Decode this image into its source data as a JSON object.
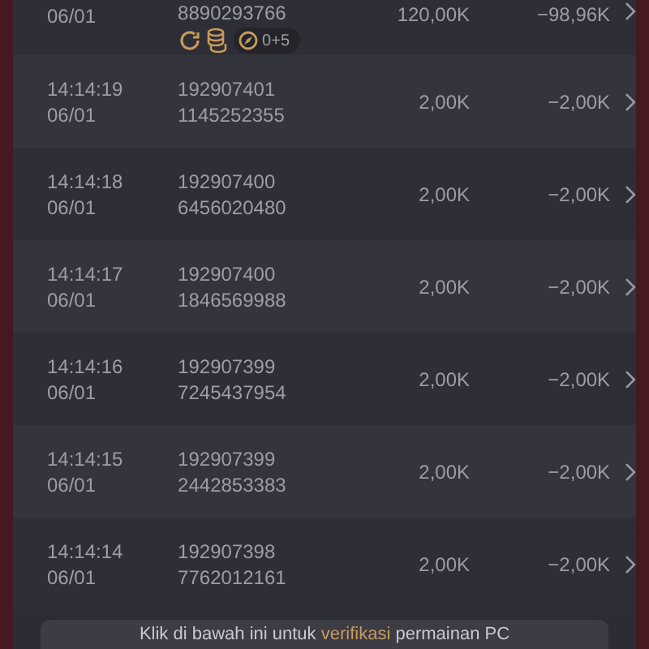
{
  "rows": [
    {
      "date": "06/01",
      "id_line_2": "8890293766",
      "amount": "120,00K",
      "result": "−98,96K",
      "badge": "0+5"
    },
    {
      "time": "14:14:19",
      "date": "06/01",
      "id_line_1": "192907401",
      "id_line_2": "1145252355",
      "amount": "2,00K",
      "result": "−2,00K"
    },
    {
      "time": "14:14:18",
      "date": "06/01",
      "id_line_1": "192907400",
      "id_line_2": "6456020480",
      "amount": "2,00K",
      "result": "−2,00K"
    },
    {
      "time": "14:14:17",
      "date": "06/01",
      "id_line_1": "192907400",
      "id_line_2": "1846569988",
      "amount": "2,00K",
      "result": "−2,00K"
    },
    {
      "time": "14:14:16",
      "date": "06/01",
      "id_line_1": "192907399",
      "id_line_2": "7245437954",
      "amount": "2,00K",
      "result": "−2,00K"
    },
    {
      "time": "14:14:15",
      "date": "06/01",
      "id_line_1": "192907399",
      "id_line_2": "2442853383",
      "amount": "2,00K",
      "result": "−2,00K"
    },
    {
      "time": "14:14:14",
      "date": "06/01",
      "id_line_1": "192907398",
      "id_line_2": "7762012161",
      "amount": "2,00K",
      "result": "−2,00K"
    }
  ],
  "banner": {
    "before": "Klik di bawah ini untuk ",
    "link": "verifikasi",
    "after": " permainan PC"
  }
}
